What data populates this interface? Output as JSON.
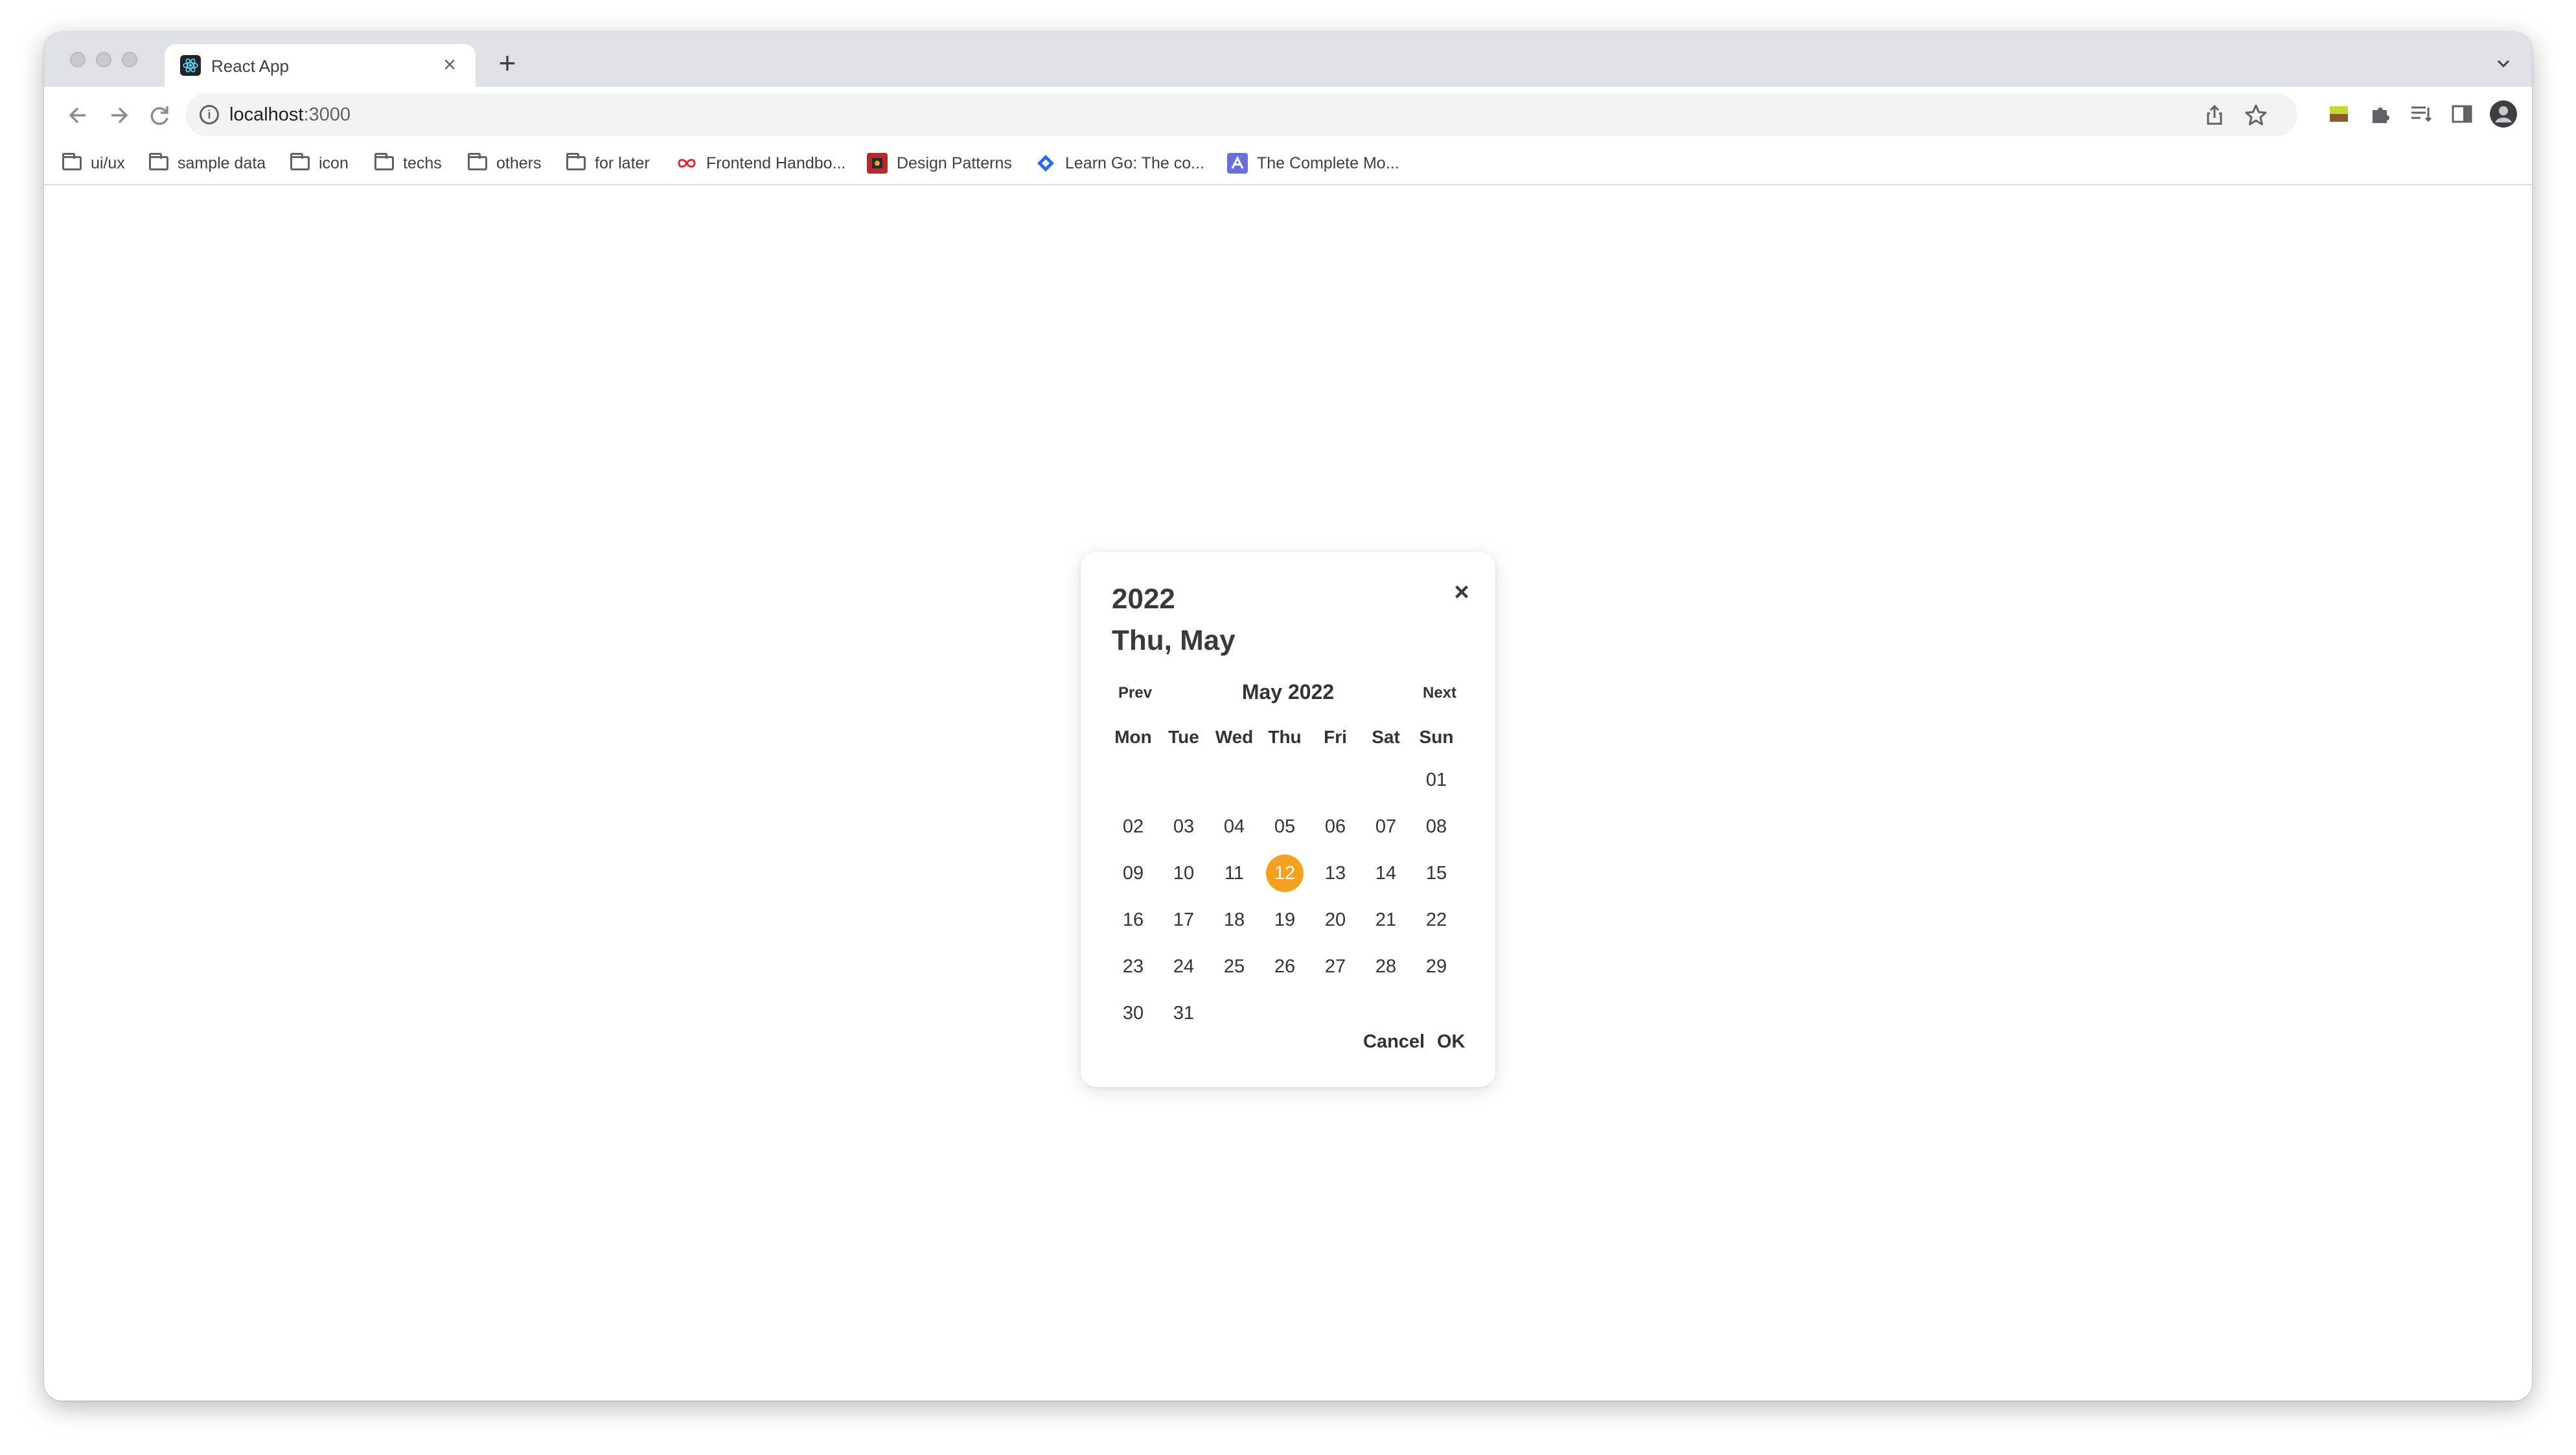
{
  "browser": {
    "tab_title": "React App",
    "tab_close": "×",
    "new_tab": "+",
    "url_host": "localhost",
    "url_port": ":3000",
    "bookmarks": [
      {
        "label": "ui/ux",
        "icon": "folder-icon"
      },
      {
        "label": "sample data",
        "icon": "folder-icon"
      },
      {
        "label": "icon",
        "icon": "folder-icon"
      },
      {
        "label": "techs",
        "icon": "folder-icon"
      },
      {
        "label": "others",
        "icon": "folder-icon"
      },
      {
        "label": "for later",
        "icon": "folder-icon"
      },
      {
        "label": "Frontend Handbo...",
        "icon": "infinity-icon"
      },
      {
        "label": "Design Patterns",
        "icon": "refactoring-icon"
      },
      {
        "label": "Learn Go: The co...",
        "icon": "diamond-icon"
      },
      {
        "label": "The Complete Mo...",
        "icon": "course-icon"
      }
    ]
  },
  "picker": {
    "year": "2022",
    "date_label": "Thu, May",
    "close": "×",
    "prev": "Prev",
    "next": "Next",
    "month_label": "May 2022",
    "weekdays": [
      "Mon",
      "Tue",
      "Wed",
      "Thu",
      "Fri",
      "Sat",
      "Sun"
    ],
    "weeks": [
      [
        "",
        "",
        "",
        "",
        "",
        "",
        "01"
      ],
      [
        "02",
        "03",
        "04",
        "05",
        "06",
        "07",
        "08"
      ],
      [
        "09",
        "10",
        "11",
        "12",
        "13",
        "14",
        "15"
      ],
      [
        "16",
        "17",
        "18",
        "19",
        "20",
        "21",
        "22"
      ],
      [
        "23",
        "24",
        "25",
        "26",
        "27",
        "28",
        "29"
      ],
      [
        "30",
        "31",
        "",
        "",
        "",
        "",
        ""
      ]
    ],
    "selected_day": "12",
    "cancel": "Cancel",
    "ok": "OK",
    "accent_color": "#f4a020"
  }
}
